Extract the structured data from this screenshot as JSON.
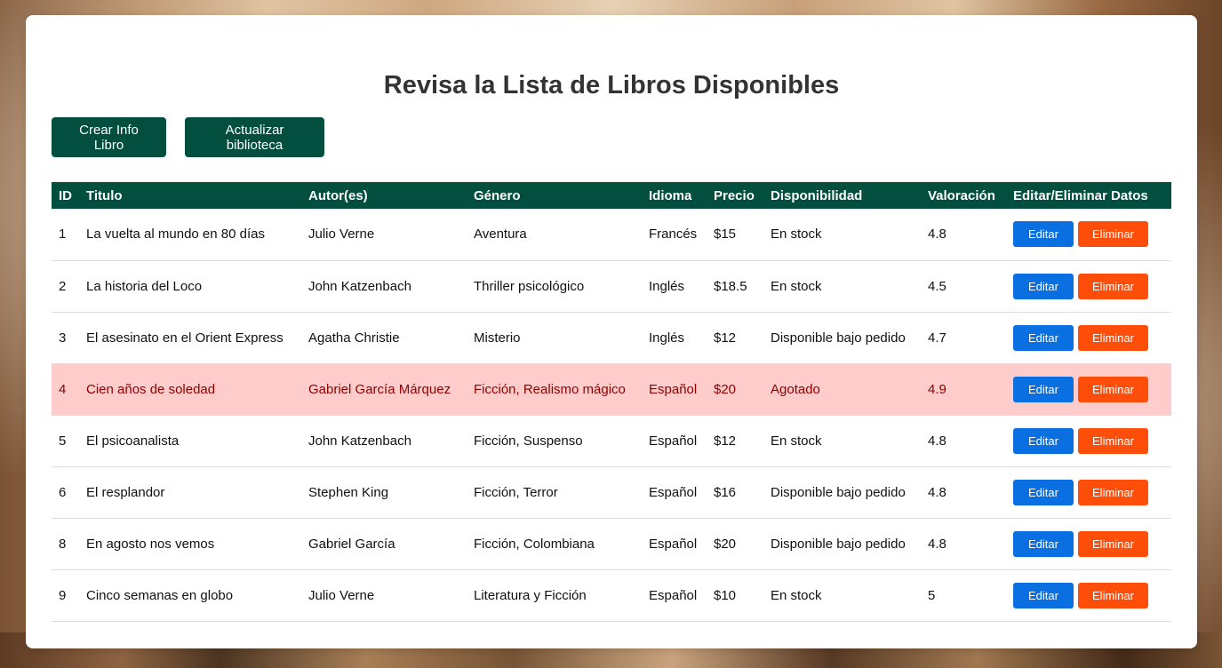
{
  "page": {
    "title": "Revisa la Lista de Libros Disponibles",
    "create_button": "Crear Info Libro",
    "update_button": "Actualizar biblioteca"
  },
  "table": {
    "headers": [
      "ID",
      "Titulo",
      "Autor(es)",
      "Género",
      "Idioma",
      "Precio",
      "Disponibilidad",
      "Valoración",
      "Editar/Eliminar Datos"
    ],
    "edit_label": "Editar",
    "delete_label": "Eliminar",
    "rows": [
      {
        "id": "1",
        "titulo": "La vuelta al mundo en 80 días",
        "autor": "Julio Verne",
        "genero": "Aventura",
        "idioma": "Francés",
        "precio": "$15",
        "disponibilidad": "En stock",
        "valoracion": "4.8",
        "agotado": false
      },
      {
        "id": "2",
        "titulo": "La historia del Loco",
        "autor": "John Katzenbach",
        "genero": "Thriller psicológico",
        "idioma": "Inglés",
        "precio": "$18.5",
        "disponibilidad": "En stock",
        "valoracion": "4.5",
        "agotado": false
      },
      {
        "id": "3",
        "titulo": "El asesinato en el Orient Express",
        "autor": "Agatha Christie",
        "genero": "Misterio",
        "idioma": "Inglés",
        "precio": "$12",
        "disponibilidad": "Disponible bajo pedido",
        "valoracion": "4.7",
        "agotado": false
      },
      {
        "id": "4",
        "titulo": "Cien años de soledad",
        "autor": "Gabriel García Márquez",
        "genero": "Ficción, Realismo mágico",
        "idioma": "Español",
        "precio": "$20",
        "disponibilidad": "Agotado",
        "valoracion": "4.9",
        "agotado": true
      },
      {
        "id": "5",
        "titulo": "El psicoanalista",
        "autor": "John Katzenbach",
        "genero": "Ficción, Suspenso",
        "idioma": "Español",
        "precio": "$12",
        "disponibilidad": "En stock",
        "valoracion": "4.8",
        "agotado": false
      },
      {
        "id": "6",
        "titulo": "El resplandor",
        "autor": "Stephen King",
        "genero": "Ficción, Terror",
        "idioma": "Español",
        "precio": "$16",
        "disponibilidad": "Disponible bajo pedido",
        "valoracion": "4.8",
        "agotado": false
      },
      {
        "id": "8",
        "titulo": "En agosto nos vemos",
        "autor": "Gabriel García",
        "genero": "Ficción, Colombiana",
        "idioma": "Español",
        "precio": "$20",
        "disponibilidad": "Disponible bajo pedido",
        "valoracion": "4.8",
        "agotado": false
      },
      {
        "id": "9",
        "titulo": "Cinco semanas en globo",
        "autor": "Julio Verne",
        "genero": "Literatura y Ficción",
        "idioma": "Español",
        "precio": "$10",
        "disponibilidad": "En stock",
        "valoracion": "5",
        "agotado": false
      }
    ]
  },
  "colors": {
    "primary": "#024f40",
    "edit": "#0a6fe0",
    "delete": "#ff4d0a",
    "out_of_stock_bg": "#ffcccc",
    "out_of_stock_text": "#8b0000"
  }
}
